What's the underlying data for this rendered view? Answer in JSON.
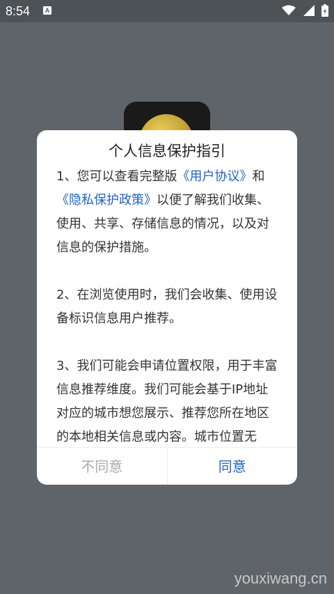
{
  "status_bar": {
    "time": "8:54",
    "notification_icon": "A"
  },
  "dialog": {
    "title": "个人信息保护指引",
    "p1": {
      "pre": "1、您可以查看完整版",
      "link1": "《用户协议》",
      "mid": "和",
      "link2": "《隐私保护政策》",
      "post": "以便了解我们收集、使用、共享、存储信息的情况，以及对信息的保护措施。"
    },
    "p2": "2、在浏览使用时，我们会收集、使用设备标识信息用户推荐。",
    "p3": "3、我们可能会申请位置权限，用于丰富信息推荐维度。我们可能会基于IP地址对应的城市想您展示、推荐您所在地区的本地相关信息或内容。城市位置无",
    "buttons": {
      "disagree": "不同意",
      "agree": "同意"
    }
  },
  "watermark": "youxiwang.cn",
  "colors": {
    "link": "#1e63c4",
    "overlay": "#5f6469"
  },
  "icons": [
    "wifi-icon",
    "signal-icon",
    "battery-icon"
  ]
}
